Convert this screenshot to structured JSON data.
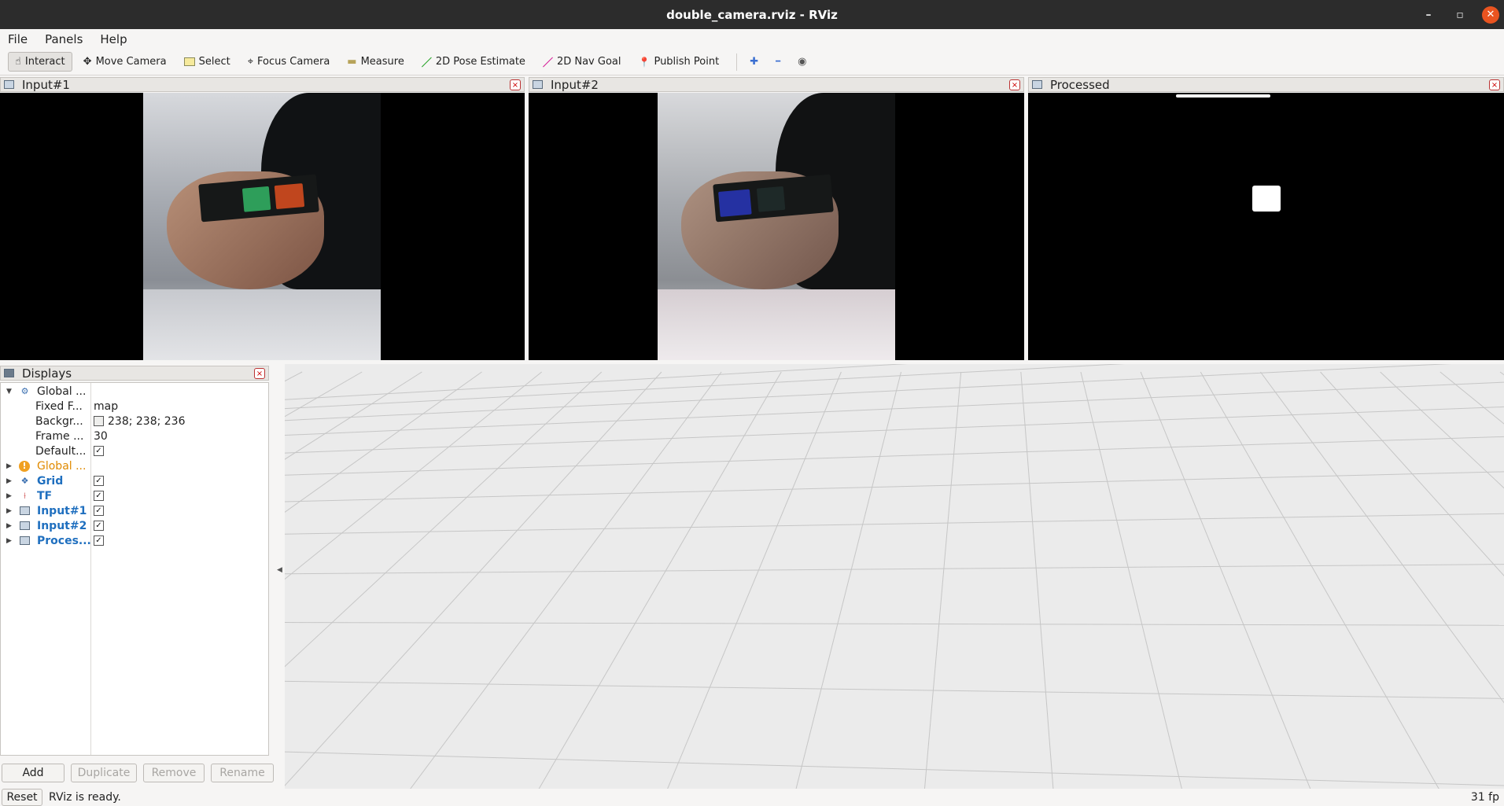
{
  "window": {
    "title": "double_camera.rviz - RViz",
    "minimize": "–",
    "maximize": "▫",
    "close": "✕"
  },
  "menu": [
    "File",
    "Panels",
    "Help"
  ],
  "toolbar": {
    "tools": [
      {
        "label": "Interact",
        "icon": "☝"
      },
      {
        "label": "Move Camera",
        "icon": "✥"
      },
      {
        "label": "Select",
        "icon": "▭"
      },
      {
        "label": "Focus Camera",
        "icon": "⌖"
      },
      {
        "label": "Measure",
        "icon": "▬"
      },
      {
        "label": "2D Pose Estimate",
        "icon": "／"
      },
      {
        "label": "2D Nav Goal",
        "icon": "／"
      },
      {
        "label": "Publish Point",
        "icon": "📍"
      }
    ],
    "add": "✚",
    "remove": "━",
    "view": "◉"
  },
  "panels": {
    "input1": "Input#1",
    "input2": "Input#2",
    "processed": "Processed",
    "close": "×"
  },
  "displays": {
    "title": "Displays",
    "rows": [
      {
        "label": "Global ...",
        "value": ""
      },
      {
        "label": "Fixed F...",
        "value": "map"
      },
      {
        "label": "Backgr...",
        "value": "238; 238; 236"
      },
      {
        "label": "Frame ...",
        "value": "30"
      },
      {
        "label": "Default...",
        "value": ""
      },
      {
        "label": "Global ...",
        "value": ""
      },
      {
        "label": "Grid",
        "value": ""
      },
      {
        "label": "TF",
        "value": ""
      },
      {
        "label": "Input#1",
        "value": ""
      },
      {
        "label": "Input#2",
        "value": ""
      },
      {
        "label": "Proces...",
        "value": ""
      }
    ],
    "check": "✓",
    "buttons": {
      "add": "Add",
      "duplicate": "Duplicate",
      "remove": "Remove",
      "rename": "Rename"
    }
  },
  "status": {
    "reset": "Reset",
    "message": "RViz is ready.",
    "fps": "31 fp"
  },
  "colors": {
    "accent": "#e95420",
    "blue": "#1f6fbf",
    "orange": "#e08a00",
    "green_square": "#2e9e5a",
    "orange_square": "#c0461e",
    "blue_square": "#1d2fd0"
  }
}
